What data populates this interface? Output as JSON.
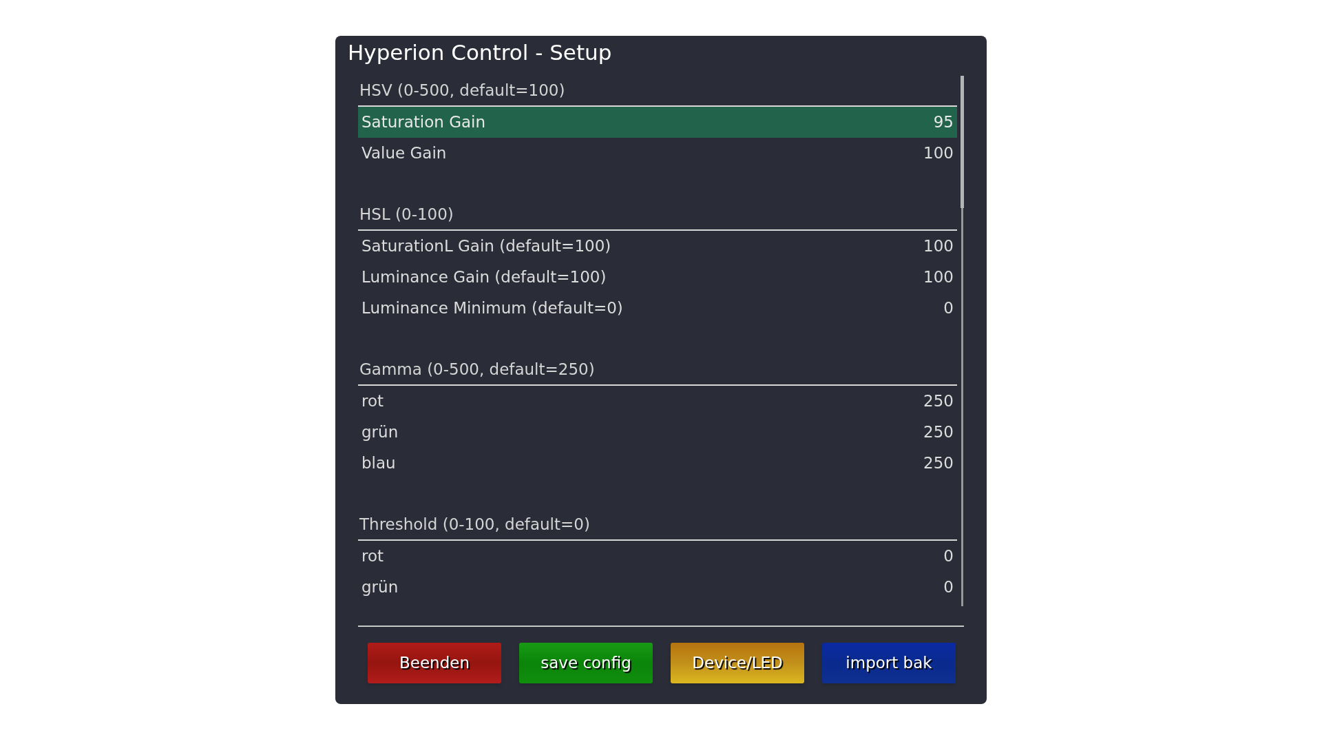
{
  "window": {
    "title": "Hyperion Control - Setup"
  },
  "sections": [
    {
      "title": "HSV (0-500, default=100)",
      "rows": [
        {
          "label": "Saturation Gain",
          "value": "95",
          "selected": true
        },
        {
          "label": "Value Gain",
          "value": "100",
          "selected": false
        }
      ]
    },
    {
      "title": "HSL (0-100)",
      "rows": [
        {
          "label": "SaturationL Gain (default=100)",
          "value": "100",
          "selected": false
        },
        {
          "label": "Luminance Gain (default=100)",
          "value": "100",
          "selected": false
        },
        {
          "label": "Luminance Minimum (default=0)",
          "value": "0",
          "selected": false
        }
      ]
    },
    {
      "title": "Gamma (0-500, default=250)",
      "rows": [
        {
          "label": "rot",
          "value": "250",
          "selected": false
        },
        {
          "label": "grün",
          "value": "250",
          "selected": false
        },
        {
          "label": "blau",
          "value": "250",
          "selected": false
        }
      ]
    },
    {
      "title": "Threshold (0-100, default=0)",
      "rows": [
        {
          "label": "rot",
          "value": "0",
          "selected": false
        },
        {
          "label": "grün",
          "value": "0",
          "selected": false
        }
      ]
    }
  ],
  "buttons": [
    {
      "label": "Beenden",
      "kind": "red"
    },
    {
      "label": "save config",
      "kind": "green"
    },
    {
      "label": "Device/LED",
      "kind": "yellow"
    },
    {
      "label": "import bak",
      "kind": "blue"
    }
  ]
}
